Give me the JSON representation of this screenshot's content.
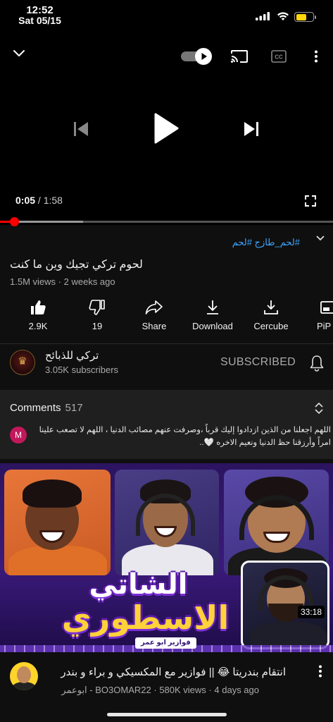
{
  "status_bar": {
    "time": "12:52",
    "date": "Sat 05/15",
    "battery_level": 0.65,
    "battery_color": "#ffd60a"
  },
  "player": {
    "current_time": "0:05",
    "separator": "/",
    "duration": "1:58",
    "progress_fraction": 0.042,
    "buffered_fraction": 0.25,
    "autoplay_on": true,
    "icons": [
      "chevron-down-icon",
      "autoplay-toggle-icon",
      "cast-icon",
      "captions-icon",
      "more-vertical-icon",
      "skip-previous-icon",
      "play-icon",
      "skip-next-icon",
      "fullscreen-icon"
    ],
    "accent_color": "#ff0000"
  },
  "video": {
    "hashtags": "#لحم_طازج #لحم",
    "title": "لحوم تركي تجيك وين ما كنت",
    "views": "1.5M views",
    "dot": "·",
    "age": "2 weeks ago"
  },
  "actions": [
    {
      "icon": "like-icon",
      "label": "2.9K"
    },
    {
      "icon": "dislike-icon",
      "label": "19"
    },
    {
      "icon": "share-icon",
      "label": "Share"
    },
    {
      "icon": "download-icon",
      "label": "Download"
    },
    {
      "icon": "cercube-icon",
      "label": "Cercube"
    },
    {
      "icon": "pip-icon",
      "label": "PiP"
    }
  ],
  "channel": {
    "name": "تركي للذبائح",
    "subscribers": "3.05K subscribers",
    "subscribe_state": "SUBSCRIBED"
  },
  "comments": {
    "heading": "Comments",
    "count": "517",
    "top_comment": {
      "avatar_letter": "M",
      "avatar_color": "#c2185b",
      "text": "اللهم اجعلنا من الذين ازدادوا إليك قرباً ،وصرفت عنهم مصائب الدنيا ، اللهم لا تصعب علينا امراً وأرزقنا حظ الدنيا ونعيم الاخره 🤍.."
    }
  },
  "next_video": {
    "thumbnail_text_line1": "الشاتي",
    "thumbnail_text_line2": "الاسطوري",
    "thumbnail_badge": "فوازير ابو عمر",
    "duration": "33:18",
    "title": "انتقام بندريتا 😂 || فوازير مع المكسيكي و براء و بندر",
    "channel": "ابوعمر - BO3OMAR22",
    "views": "580K views",
    "dot": "·",
    "age": "4 days ago"
  }
}
